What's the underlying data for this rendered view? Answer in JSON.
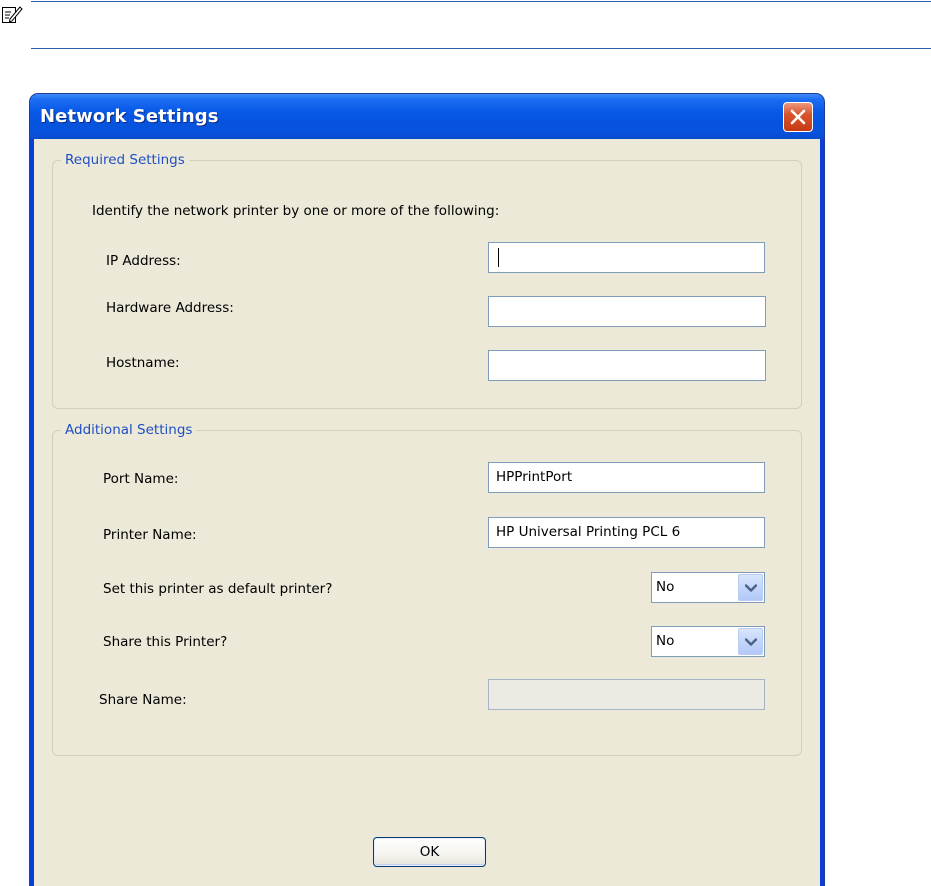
{
  "document": {
    "note_icon": "note-pencil-icon"
  },
  "dialog": {
    "title": "Network Settings",
    "close_icon": "close-icon",
    "required_settings": {
      "legend": "Required Settings",
      "instruction": "Identify the network printer by one or more of the following:",
      "ip_address": {
        "label": "IP Address:",
        "value": ""
      },
      "hardware_address": {
        "label": "Hardware Address:",
        "value": ""
      },
      "hostname": {
        "label": "Hostname:",
        "value": ""
      }
    },
    "additional_settings": {
      "legend": "Additional Settings",
      "port_name": {
        "label": "Port Name:",
        "value": "HPPrintPort"
      },
      "printer_name": {
        "label": "Printer Name:",
        "value": "HP Universal Printing PCL 6"
      },
      "default_printer": {
        "label": "Set this printer as default printer?",
        "value": "No"
      },
      "share_printer": {
        "label": "Share this Printer?",
        "value": "No"
      },
      "share_name": {
        "label": "Share Name:",
        "value": ""
      }
    },
    "ok_label": "OK"
  },
  "colors": {
    "titlebar": "#0a5be8",
    "dialog_background": "#ece9d8",
    "group_legend": "#1f4fc4",
    "close_button": "#d9542c",
    "rule": "#2c5ea8"
  }
}
